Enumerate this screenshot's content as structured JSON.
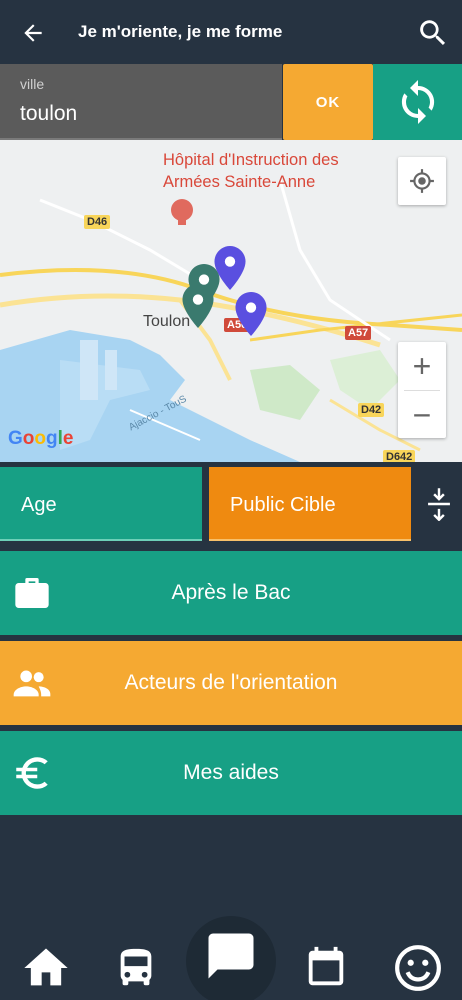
{
  "header": {
    "title": "Je m'oriente, je me forme",
    "back_icon": "arrow-left-icon",
    "search_icon": "search-icon"
  },
  "city_search": {
    "label": "ville",
    "value": "toulon",
    "ok_label": "OK",
    "refresh_icon": "refresh-icon"
  },
  "map": {
    "hospital_label_line1": "Hôpital d'Instruction des",
    "hospital_label_line2": "Armées Sainte-Anne",
    "town_label": "Toulon",
    "roads": [
      "D46",
      "A50",
      "A57",
      "D42",
      "D642"
    ],
    "road_text": "Ajaccio - TouS",
    "attribution": "Google",
    "zoom_in": "+",
    "zoom_out": "−"
  },
  "filters": {
    "age_label": "Age",
    "public_label": "Public Cible",
    "sort_icon": "expand-collapse-icon"
  },
  "menu": {
    "bac_label": "Après le Bac",
    "acteurs_label": "Acteurs de l'orientation",
    "aides_label": "Mes aides"
  },
  "colors": {
    "background": "#263341",
    "green": "#17a085",
    "orange": "#f5a932",
    "dark_orange": "#ef8a10"
  },
  "bottom_nav": [
    "home-icon",
    "bus-icon",
    "chat-icon",
    "calendar-icon",
    "smiley-icon"
  ]
}
